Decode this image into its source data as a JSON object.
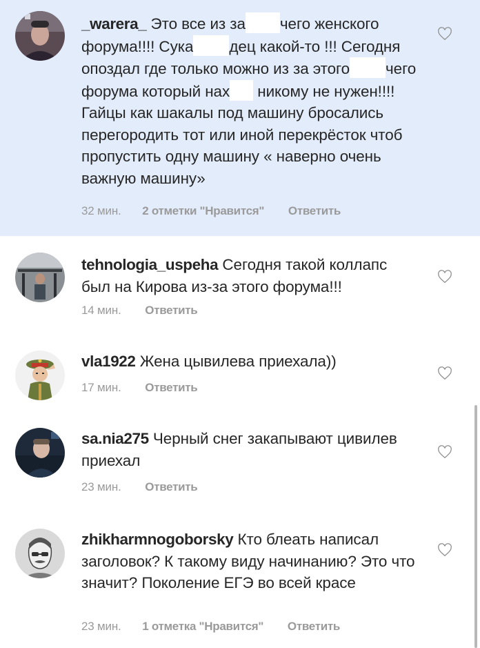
{
  "colors": {
    "highlight_bg": "#e3ecfb",
    "text": "#262626",
    "meta": "#9a9a9a"
  },
  "comments": [
    {
      "username": "_warera_",
      "text_parts": [
        "Это все из за",
        "чего женского форума!!!! Сука",
        "дец какой-то !!! Сегодня опоздал где только можно из за этого",
        "чего форума который нах",
        "никому не нужен!!!! Гайцы как шакалы под машину бросались перегородить тот или иной перекрёсток чтоб пропустить одну машину « наверно очень важную машину»"
      ],
      "time": "32 мин.",
      "likes": "2 отметки \"Нравится\"",
      "reply": "Ответить",
      "avatar_icon": "avatar-photo-icon"
    },
    {
      "username": "tehnologia_uspeha",
      "text": "Сегодня такой коллапс был на Кирова из-за этого форума!!!",
      "time": "14 мин.",
      "reply": "Ответить",
      "avatar_icon": "avatar-gym-icon"
    },
    {
      "username": "vla1922",
      "text": "Жена цывилева приехала))",
      "time": "17 мин.",
      "reply": "Ответить",
      "avatar_icon": "avatar-soldier-icon"
    },
    {
      "username": "sa.nia275",
      "text": "Черный снег закапывают цивилев приехал",
      "time": "23 мин.",
      "reply": "Ответить",
      "avatar_icon": "avatar-photo-icon"
    },
    {
      "username": "zhikharmnogoborsky",
      "text": "Кто блеать написал заголовок? К такому виду начинанию? Это что значит? Поколение ЕГЭ во всей красе",
      "time": "23 мин.",
      "likes": "1 отметка \"Нравится\"",
      "reply": "Ответить",
      "avatar_icon": "avatar-sketch-icon"
    }
  ]
}
